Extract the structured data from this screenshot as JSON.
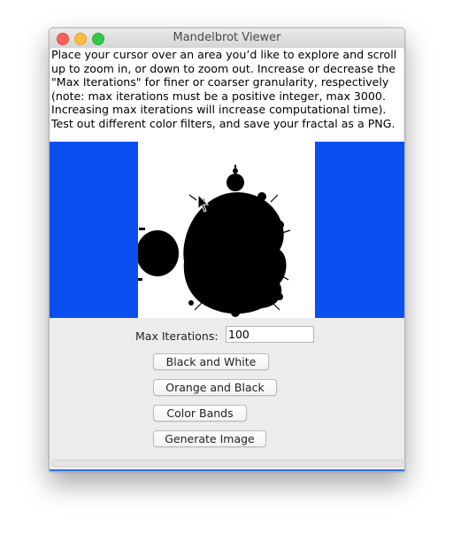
{
  "window": {
    "title": "Mandelbrot Viewer"
  },
  "instructions": {
    "lines": [
      "Place your cursor over an area you’d like to explore and scroll",
      "up to zoom in, or down to zoom out. Increase or decrease the",
      "\"Max Iterations\" for finer or coarser granularity, respectively",
      "(note: max iterations must be a positive integer, max 3000.",
      "Increasing max iterations will increase computational time).",
      "Test out different color filters, and save your fractal as a PNG."
    ]
  },
  "controls": {
    "max_iterations_label": "Max Iterations:",
    "max_iterations_value": "100",
    "buttons": {
      "black_and_white": "Black and White",
      "orange_and_black": "Orange and Black",
      "color_bands": "Color Bands",
      "generate_image": "Generate Image"
    }
  },
  "colors": {
    "viewer_background": "#0a4ff0",
    "fractal_fill": "#000000",
    "fractal_background": "#ffffff"
  }
}
